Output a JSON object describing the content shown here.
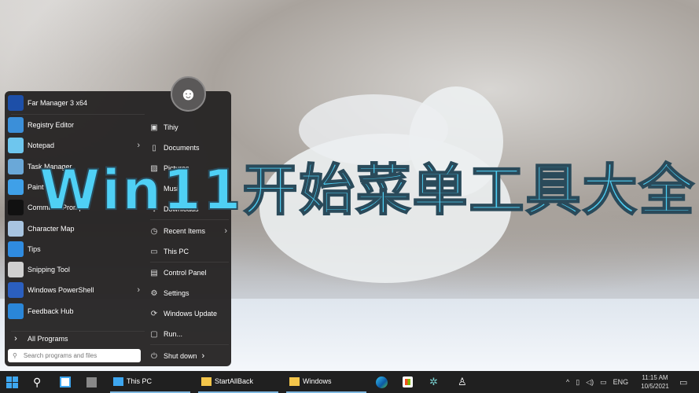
{
  "overlay_title": "Win11开始菜单工具大全",
  "start_menu": {
    "pinned": {
      "label": "Far Manager 3 x64"
    },
    "programs": [
      {
        "label": "Registry Editor",
        "color": "#3b8fd9",
        "submenu": false
      },
      {
        "label": "Notepad",
        "color": "#6ec6ee",
        "submenu": true
      },
      {
        "label": "Task Manager",
        "color": "#6aa8d8",
        "submenu": false
      },
      {
        "label": "Paint",
        "color": "#3fa0e8",
        "submenu": false
      },
      {
        "label": "Command Prompt",
        "color": "#111111",
        "submenu": false
      },
      {
        "label": "Character Map",
        "color": "#a8c4e0",
        "submenu": false
      },
      {
        "label": "Tips",
        "color": "#2f8be0",
        "submenu": false
      },
      {
        "label": "Snipping Tool",
        "color": "#d0d0d0",
        "submenu": false
      },
      {
        "label": "Windows PowerShell",
        "color": "#2b5fbf",
        "submenu": true
      },
      {
        "label": "Feedback Hub",
        "color": "#2a86d8",
        "submenu": false
      }
    ],
    "all_programs": "All Programs",
    "search_placeholder": "Search programs and files",
    "places": [
      {
        "label": "Tihiy",
        "icon": "user-folder-icon",
        "glyph": "▣"
      },
      {
        "label": "Documents",
        "icon": "document-icon",
        "glyph": "▯"
      },
      {
        "label": "Pictures",
        "icon": "pictures-icon",
        "glyph": "▨"
      },
      {
        "label": "Music",
        "icon": "music-icon",
        "glyph": "♪"
      },
      {
        "label": "Downloads",
        "icon": "download-icon",
        "glyph": "↓"
      },
      {
        "label": "Recent Items",
        "icon": "clock-icon",
        "glyph": "◷",
        "submenu": true
      },
      {
        "label": "This PC",
        "icon": "computer-icon",
        "glyph": "▭"
      },
      {
        "label": "Control Panel",
        "icon": "control-panel-icon",
        "glyph": "▤"
      },
      {
        "label": "Settings",
        "icon": "gear-icon",
        "glyph": "⚙"
      },
      {
        "label": "Windows Update",
        "icon": "update-icon",
        "glyph": "⟳"
      },
      {
        "label": "Run...",
        "icon": "run-icon",
        "glyph": "▢"
      }
    ],
    "shutdown": "Shut down"
  },
  "taskbar": {
    "apps": [
      {
        "label": "This PC"
      },
      {
        "label": "StartAllBack"
      },
      {
        "label": "Windows"
      }
    ],
    "language": "ENG",
    "time": "11:15 AM",
    "date": "10/5/2021"
  }
}
